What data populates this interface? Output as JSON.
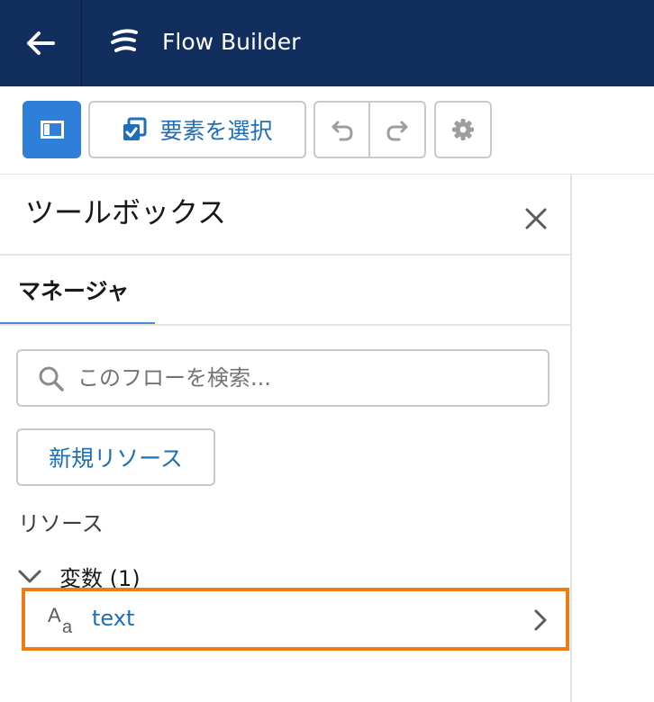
{
  "header": {
    "title": "Flow Builder",
    "back_icon": "arrow-left-icon",
    "logo_icon": "flow-logo-icon"
  },
  "toolbar": {
    "toggle_icon": "panel-toggle-icon",
    "select_elements_label": "要素を選択",
    "select_elements_icon": "checkbox-copy-icon",
    "undo_icon": "undo-icon",
    "redo_icon": "redo-icon",
    "settings_icon": "gear-icon"
  },
  "toolbox": {
    "title": "ツールボックス",
    "close_icon": "close-icon",
    "tabs": [
      {
        "label": "マネージャ",
        "active": true
      }
    ],
    "search": {
      "placeholder": "このフローを検索...",
      "value": ""
    },
    "new_resource_label": "新規リソース",
    "resources_heading": "リソース",
    "sections": [
      {
        "label": "変数 (1)",
        "expanded": true,
        "items": [
          {
            "name": "text",
            "type_icon": "text-type-icon"
          }
        ]
      }
    ]
  },
  "colors": {
    "header_bg": "#112e5e",
    "accent": "#2f7ed8",
    "link": "#1f6fb8",
    "highlight": "#f07b12"
  }
}
